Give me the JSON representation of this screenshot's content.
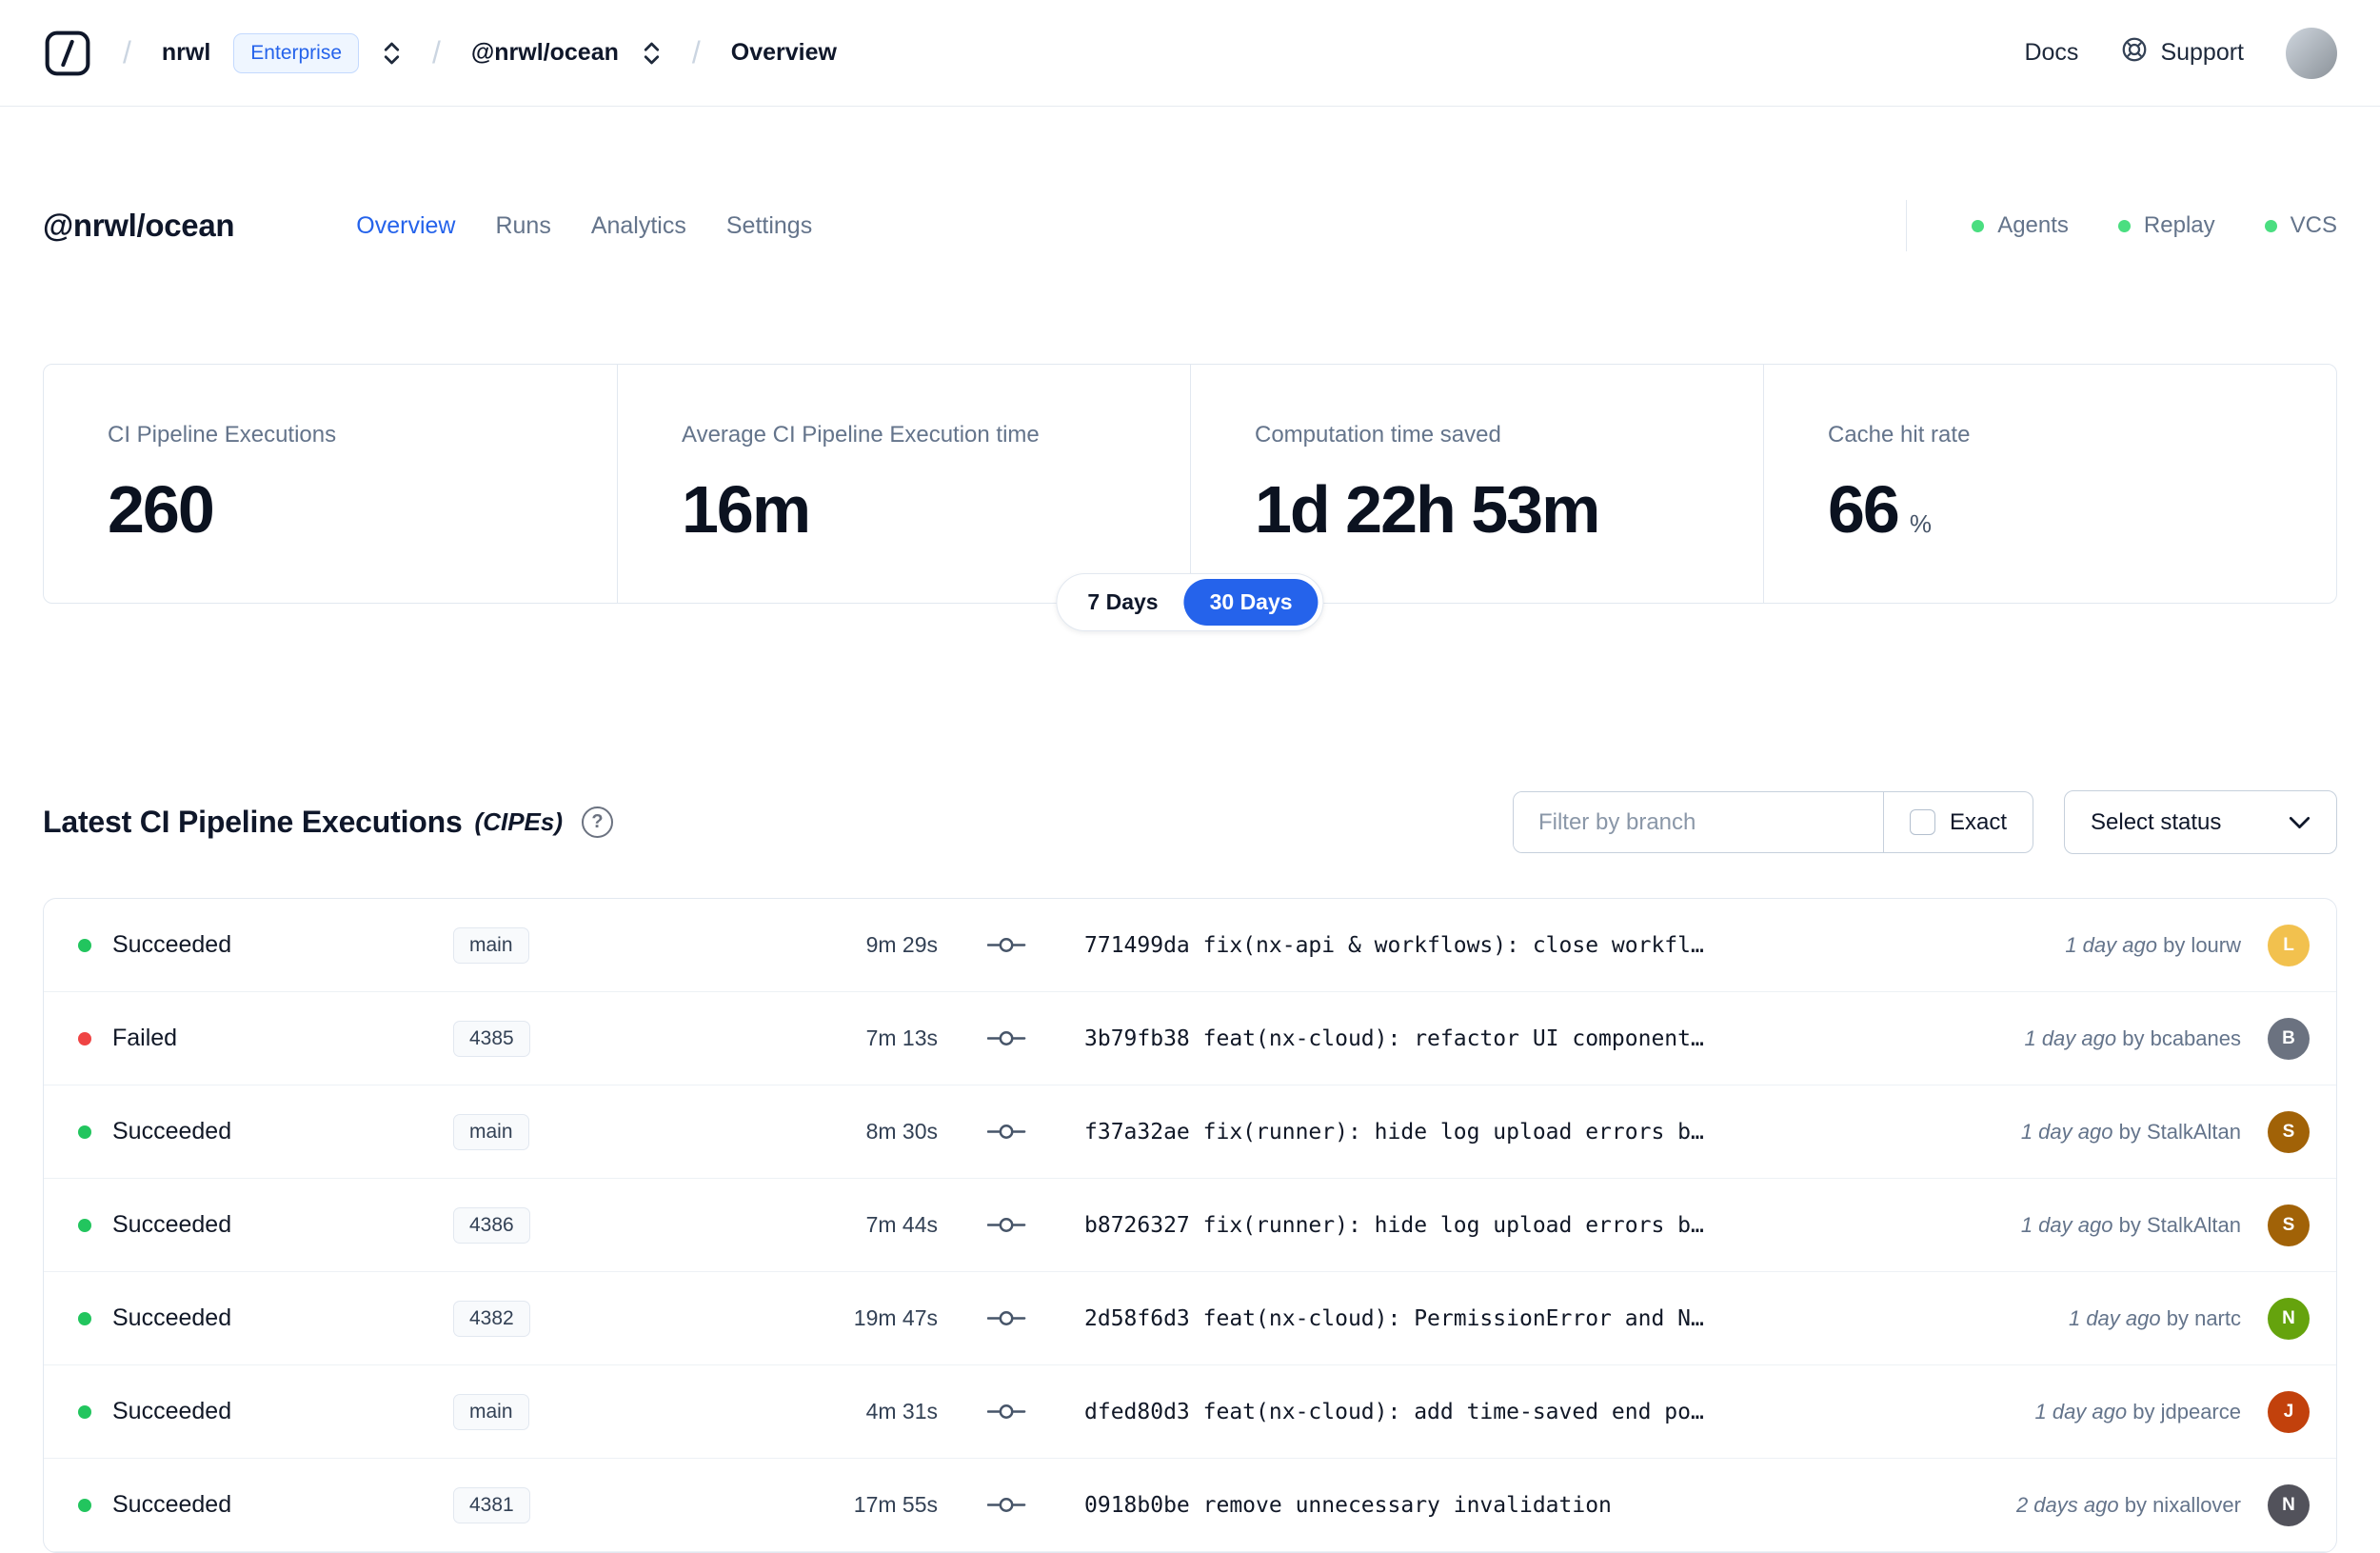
{
  "nav": {
    "breadcrumb": {
      "separator": "/",
      "org": "nrwl",
      "org_badge": "Enterprise",
      "workspace": "@nrwl/ocean",
      "page": "Overview"
    },
    "docs_label": "Docs",
    "support_label": "Support"
  },
  "header": {
    "title": "@nrwl/ocean",
    "tabs": [
      {
        "label": "Overview",
        "active": true
      },
      {
        "label": "Runs",
        "active": false
      },
      {
        "label": "Analytics",
        "active": false
      },
      {
        "label": "Settings",
        "active": false
      }
    ],
    "statuses": [
      {
        "label": "Agents",
        "dot_color": "#4ade80"
      },
      {
        "label": "Replay",
        "dot_color": "#4ade80"
      },
      {
        "label": "VCS",
        "dot_color": "#4ade80"
      }
    ]
  },
  "stats": {
    "cards": [
      {
        "label": "CI Pipeline Executions",
        "value": "260"
      },
      {
        "label": "Average CI Pipeline Execution time",
        "value": "16m"
      },
      {
        "label": "Computation time saved",
        "value": "1d 22h 53m"
      },
      {
        "label": "Cache hit rate",
        "value": "66",
        "suffix": "%"
      }
    ],
    "range": [
      {
        "label": "7 Days",
        "active": false
      },
      {
        "label": "30 Days",
        "active": true
      }
    ],
    "accent_color": "#2563eb"
  },
  "cipes": {
    "title": "Latest CI Pipeline Executions",
    "title_suffix": "(CIPEs)",
    "help_glyph": "?",
    "filter_placeholder": "Filter by branch",
    "exact_label": "Exact",
    "select_label": "Select status",
    "rows": [
      {
        "status": "Succeeded",
        "dot_color": "#22c55e",
        "branch": "main",
        "duration": "9m 29s",
        "hash": "771499da",
        "message": "fix(nx-api & workflows): close workfl…",
        "time": "1 day ago",
        "author": "by lourw",
        "avatar_initial": "L",
        "avatar_color": "#f2c14e"
      },
      {
        "status": "Failed",
        "dot_color": "#ef4444",
        "branch": "4385",
        "duration": "7m 13s",
        "hash": "3b79fb38",
        "message": "feat(nx-cloud): refactor UI component…",
        "time": "1 day ago",
        "author": "by bcabanes",
        "avatar_initial": "B",
        "avatar_color": "#6b7280"
      },
      {
        "status": "Succeeded",
        "dot_color": "#22c55e",
        "branch": "main",
        "duration": "8m 30s",
        "hash": "f37a32ae",
        "message": "fix(runner): hide log upload errors b…",
        "time": "1 day ago",
        "author": "by StalkAltan",
        "avatar_initial": "S",
        "avatar_color": "#a16207"
      },
      {
        "status": "Succeeded",
        "dot_color": "#22c55e",
        "branch": "4386",
        "duration": "7m 44s",
        "hash": "b8726327",
        "message": "fix(runner): hide log upload errors b…",
        "time": "1 day ago",
        "author": "by StalkAltan",
        "avatar_initial": "S",
        "avatar_color": "#a16207"
      },
      {
        "status": "Succeeded",
        "dot_color": "#22c55e",
        "branch": "4382",
        "duration": "19m 47s",
        "hash": "2d58f6d3",
        "message": "feat(nx-cloud): PermissionError and N…",
        "time": "1 day ago",
        "author": "by nartc",
        "avatar_initial": "N",
        "avatar_color": "#65a30d"
      },
      {
        "status": "Succeeded",
        "dot_color": "#22c55e",
        "branch": "main",
        "duration": "4m 31s",
        "hash": "dfed80d3",
        "message": "feat(nx-cloud): add time-saved end po…",
        "time": "1 day ago",
        "author": "by jdpearce",
        "avatar_initial": "J",
        "avatar_color": "#c2410c"
      },
      {
        "status": "Succeeded",
        "dot_color": "#22c55e",
        "branch": "4381",
        "duration": "17m 55s",
        "hash": "0918b0be",
        "message": "remove unnecessary invalidation",
        "time": "2 days ago",
        "author": "by nixallover",
        "avatar_initial": "N",
        "avatar_color": "#52525b"
      }
    ]
  }
}
